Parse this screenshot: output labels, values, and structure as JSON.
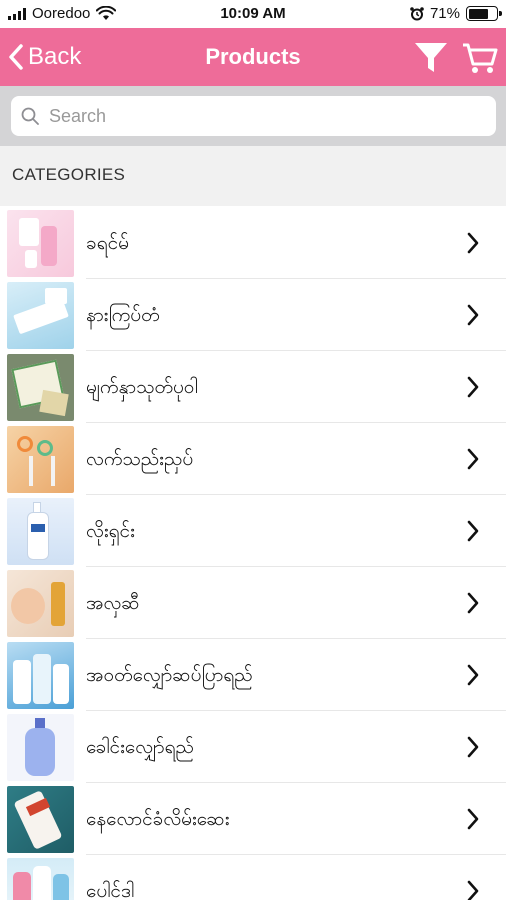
{
  "status_bar": {
    "carrier": "Ooredoo",
    "time": "10:09 AM",
    "battery_percent": "71%",
    "battery_level": 0.71,
    "icons": [
      "signal-icon",
      "wifi-icon",
      "alarm-icon",
      "battery-icon"
    ]
  },
  "navbar": {
    "back_label": "Back",
    "title": "Products",
    "icons": [
      "filter-icon",
      "cart-icon"
    ],
    "background_color": "#ee6c99"
  },
  "search": {
    "placeholder": "Search",
    "value": ""
  },
  "categories": {
    "header": "CATEGORIES",
    "items": [
      {
        "label": "ခရင်မ်",
        "thumb": "cream-product-image"
      },
      {
        "label": "နားကြပ်တံ",
        "thumb": "ear-buds-product-image"
      },
      {
        "label": "မျက်နှာသုတ်ပုဝါ",
        "thumb": "face-towel-product-image"
      },
      {
        "label": "လက်သည်းညှပ်",
        "thumb": "nail-clipper-product-image"
      },
      {
        "label": "လိုးရှင်း",
        "thumb": "lotion-product-image"
      },
      {
        "label": "အလှဆီ",
        "thumb": "beauty-oil-product-image"
      },
      {
        "label": "အဝတ်လျှော်ဆပ်ပြာရည်",
        "thumb": "laundry-detergent-product-image"
      },
      {
        "label": "ခေါင်းလျှော်ရည်",
        "thumb": "shampoo-product-image"
      },
      {
        "label": "နေလောင်ခံလိမ်းဆေး",
        "thumb": "sunscreen-product-image"
      },
      {
        "label": "ပေါင်ဒါ",
        "thumb": "powder-product-image"
      }
    ]
  }
}
